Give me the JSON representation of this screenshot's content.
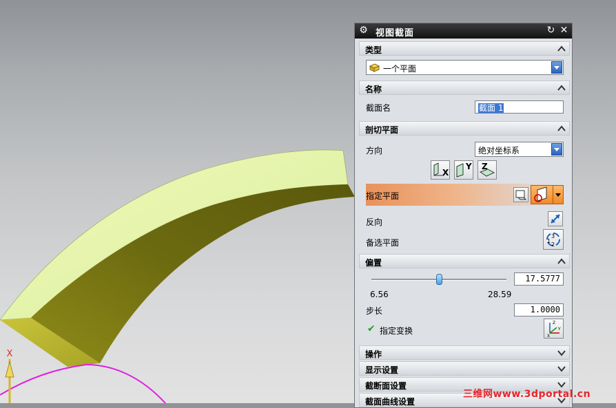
{
  "dialog": {
    "title": "视图截面",
    "type_section": {
      "header": "类型",
      "selected": "一个平面"
    },
    "name_section": {
      "header": "名称",
      "field_label": "截面名",
      "field_value": "截面 1"
    },
    "cut_plane_section": {
      "header": "剖切平面",
      "direction_label": "方向",
      "direction_value": "绝对坐标系",
      "axis_buttons": [
        "X",
        "Y",
        "Z"
      ],
      "specify_plane_label": "指定平面",
      "reverse_label": "反向",
      "alternate_plane_label": "备选平面"
    },
    "offset_section": {
      "header": "偏置",
      "value": "17.5777",
      "min_label": "6.56",
      "max_label": "28.59",
      "slider_fraction": 0.5,
      "step_label": "步长",
      "step_value": "1.0000",
      "transform_label": "指定变换"
    },
    "collapsed_sections": [
      "操作",
      "显示设置",
      "截断面设置",
      "截面曲线设置"
    ]
  },
  "viewport": {
    "axis_label": "X"
  },
  "watermark": "三维网www.3dportal.cn",
  "colors": {
    "part_top": "#e6f5a3",
    "part_side": "#6e6c12",
    "section_curve": "#e020e0",
    "highlight": "#e9965e"
  }
}
